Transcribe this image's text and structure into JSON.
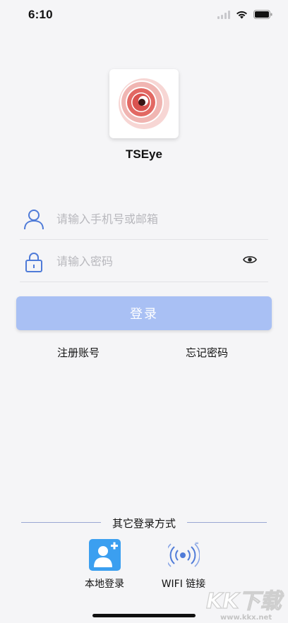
{
  "status_bar": {
    "time": "6:10"
  },
  "app": {
    "name": "TSEye"
  },
  "form": {
    "phone_placeholder": "请输入手机号或邮箱",
    "password_placeholder": "请输入密码",
    "login_label": "登录",
    "register_label": "注册账号",
    "forgot_label": "忘记密码"
  },
  "other_login": {
    "title": "其它登录方式",
    "options": [
      {
        "label": "本地登录",
        "icon": "add-user-icon"
      },
      {
        "label": "WIFI 链接",
        "icon": "wifi-signal-icon"
      }
    ]
  },
  "watermark": {
    "brand": "KK下载",
    "url": "www.kkx.net"
  },
  "colors": {
    "background": "#f5f5f7",
    "login_button": "#a9c0f4",
    "icon_blue": "#4f7bd8",
    "local_login_tile": "#3b9ff0",
    "logo_red": "#e26863"
  }
}
